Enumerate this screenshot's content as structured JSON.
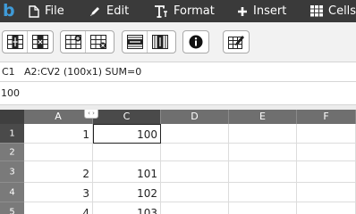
{
  "app": {
    "logo": "b"
  },
  "menu": [
    {
      "label": "File",
      "icon": "file-icon"
    },
    {
      "label": "Edit",
      "icon": "pencil-icon"
    },
    {
      "label": "Format",
      "icon": "text-format-icon"
    },
    {
      "label": "Insert",
      "icon": "plus-icon"
    },
    {
      "label": "Cells",
      "icon": "grid-icon"
    }
  ],
  "toolbar": {
    "groups": [
      [
        "insert-column-icon",
        "delete-column-icon"
      ],
      [
        "insert-row-icon",
        "delete-row-icon"
      ],
      [
        "merge-rows-icon",
        "merge-columns-icon"
      ],
      [
        "info-icon"
      ],
      [
        "edit-table-icon"
      ]
    ]
  },
  "info": {
    "cell_ref": "C1",
    "selection": "A2:CV2 (100x1) SUM=0"
  },
  "formula": {
    "value": "100"
  },
  "grid": {
    "columns": [
      "A",
      "",
      "C",
      "D",
      "E",
      "F"
    ],
    "selected_column": "C",
    "rows": [
      {
        "num": "1",
        "selected": true,
        "cells": [
          "1",
          "",
          "100",
          "",
          "",
          ""
        ]
      },
      {
        "num": "2",
        "selected": false,
        "cells": [
          "",
          "",
          "",
          "",
          "",
          ""
        ]
      },
      {
        "num": "3",
        "selected": false,
        "cells": [
          "2",
          "",
          "101",
          "",
          "",
          ""
        ]
      },
      {
        "num": "4",
        "selected": false,
        "cells": [
          "3",
          "",
          "102",
          "",
          "",
          ""
        ]
      },
      {
        "num": "5",
        "selected": false,
        "cells": [
          "4",
          "",
          "103",
          "",
          "",
          ""
        ]
      }
    ],
    "active_cell": "C1"
  },
  "colors": {
    "menubar": "#3a3a3a",
    "logo": "#3f9bd8",
    "header_dark": "#4a4a4a",
    "header": "#6f6f6f"
  }
}
